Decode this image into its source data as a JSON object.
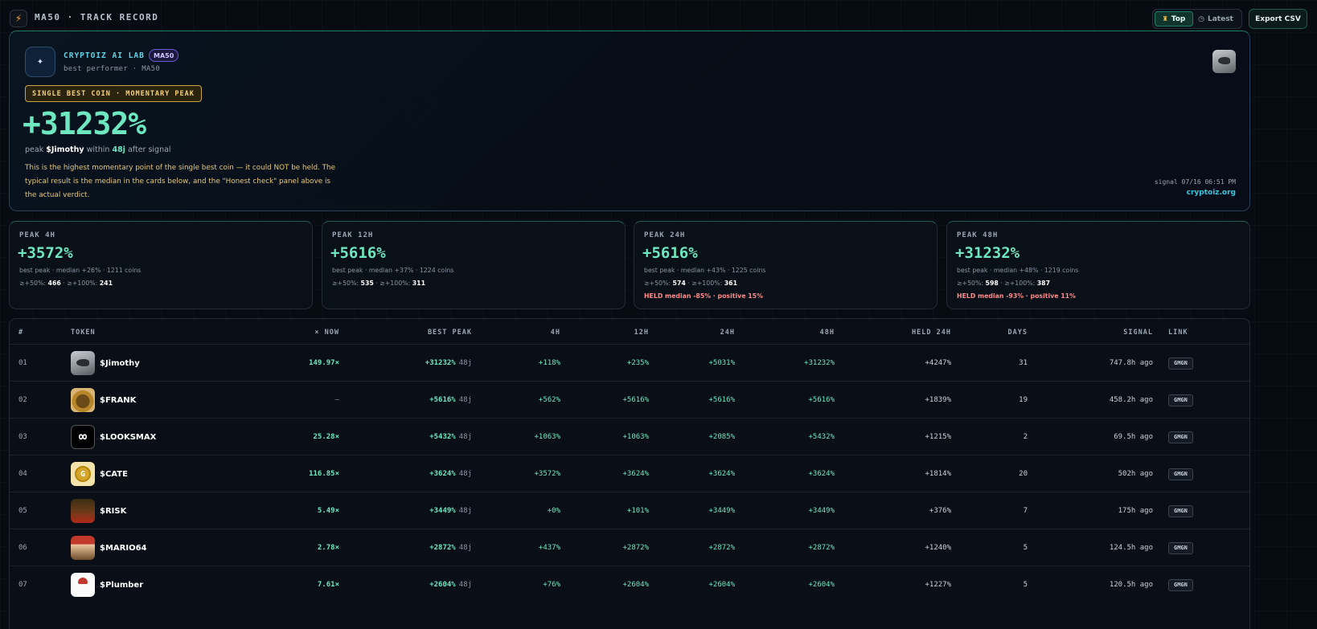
{
  "header": {
    "icon": "lightning-icon",
    "title": "MA50 · TRACK RECORD",
    "tabs": [
      {
        "label": "Top",
        "icon": "trophy-icon",
        "active": true
      },
      {
        "label": "Latest",
        "icon": "clock-icon",
        "active": false
      }
    ],
    "export_label": "Export CSV"
  },
  "hero": {
    "lab_name": "CRYPTOIZ AI LAB",
    "lab_badge": "MA50",
    "subtitle": "best performer · MA50",
    "pill": "SINGLE BEST COIN · MOMENTARY PEAK",
    "big_value": "+31232%",
    "peak_prefix": "peak",
    "peak_token": "$Jimothy",
    "peak_within": "within",
    "peak_days": "48j",
    "peak_suffix": "after signal",
    "note": "This is the highest momentary point of the single best coin — it could NOT be held. The typical result is the median in the cards below, and the \"Honest check\" panel above is the actual verdict.",
    "signal": "signal 07/16 06:51 PM",
    "site": "cryptoiz.org"
  },
  "stats": [
    {
      "label": "PEAK 4H",
      "value": "+3572%",
      "sub": "best peak · median +26% · 1211 coins",
      "thr_a_label": "≥+50%:",
      "thr_a": "466",
      "thr_b_label": "· ≥+100%:",
      "thr_b": "241",
      "held": ""
    },
    {
      "label": "PEAK 12H",
      "value": "+5616%",
      "sub": "best peak · median +37% · 1224 coins",
      "thr_a_label": "≥+50%:",
      "thr_a": "535",
      "thr_b_label": "· ≥+100%:",
      "thr_b": "311",
      "held": ""
    },
    {
      "label": "PEAK 24H",
      "value": "+5616%",
      "sub": "best peak · median +43% · 1225 coins",
      "thr_a_label": "≥+50%:",
      "thr_a": "574",
      "thr_b_label": "· ≥+100%:",
      "thr_b": "361",
      "held": "HELD median -85% · positive 15%"
    },
    {
      "label": "PEAK 48H",
      "value": "+31232%",
      "sub": "best peak · median +48% · 1219 coins",
      "thr_a_label": "≥+50%:",
      "thr_a": "598",
      "thr_b_label": "· ≥+100%:",
      "thr_b": "387",
      "held": "HELD median -93% · positive 11%"
    }
  ],
  "table": {
    "headers": [
      "#",
      "TOKEN",
      "× NOW",
      "BEST PEAK",
      "4H",
      "12H",
      "24H",
      "48H",
      "HELD 24H",
      "DAYS",
      "SIGNAL",
      "LINK"
    ],
    "rows": [
      {
        "idx": "01",
        "token": "$Jimothy",
        "img": "jimothy",
        "now": "149.97×",
        "peak": "+31232%",
        "peak_d": "48j",
        "h4": "+118%",
        "h12": "+235%",
        "h24": "+5031%",
        "h48": "+31232%",
        "held": "+4247%",
        "days": "31",
        "signal": "747.8h ago",
        "link": "GMGN"
      },
      {
        "idx": "02",
        "token": "$FRANK",
        "img": "frank",
        "now": "—",
        "peak": "+5616%",
        "peak_d": "48j",
        "h4": "+562%",
        "h12": "+5616%",
        "h24": "+5616%",
        "h48": "+5616%",
        "held": "+1839%",
        "days": "19",
        "signal": "458.2h ago",
        "link": "GMGN"
      },
      {
        "idx": "03",
        "token": "$LOOKSMAX",
        "img": "looksmax",
        "now": "25.28×",
        "peak": "+5432%",
        "peak_d": "48j",
        "h4": "+1063%",
        "h12": "+1063%",
        "h24": "+2085%",
        "h48": "+5432%",
        "held": "+1215%",
        "days": "2",
        "signal": "69.5h ago",
        "link": "GMGN"
      },
      {
        "idx": "04",
        "token": "$CATE",
        "img": "cate",
        "now": "116.85×",
        "peak": "+3624%",
        "peak_d": "48j",
        "h4": "+3572%",
        "h12": "+3624%",
        "h24": "+3624%",
        "h48": "+3624%",
        "held": "+1814%",
        "days": "20",
        "signal": "502h ago",
        "link": "GMGN"
      },
      {
        "idx": "05",
        "token": "$RISK",
        "img": "risk",
        "now": "5.49×",
        "peak": "+3449%",
        "peak_d": "48j",
        "h4": "+0%",
        "h12": "+101%",
        "h24": "+3449%",
        "h48": "+3449%",
        "held": "+376%",
        "days": "7",
        "signal": "175h ago",
        "link": "GMGN"
      },
      {
        "idx": "06",
        "token": "$MARIO64",
        "img": "mario",
        "now": "2.78×",
        "peak": "+2872%",
        "peak_d": "48j",
        "h4": "+437%",
        "h12": "+2872%",
        "h24": "+2872%",
        "h48": "+2872%",
        "held": "+1240%",
        "days": "5",
        "signal": "124.5h ago",
        "link": "GMGN"
      },
      {
        "idx": "07",
        "token": "$Plumber",
        "img": "plumber",
        "now": "7.61×",
        "peak": "+2604%",
        "peak_d": "48j",
        "h4": "+76%",
        "h12": "+2604%",
        "h24": "+2604%",
        "h48": "+2604%",
        "held": "+1227%",
        "days": "5",
        "signal": "120.5h ago",
        "link": "GMGN"
      }
    ]
  }
}
